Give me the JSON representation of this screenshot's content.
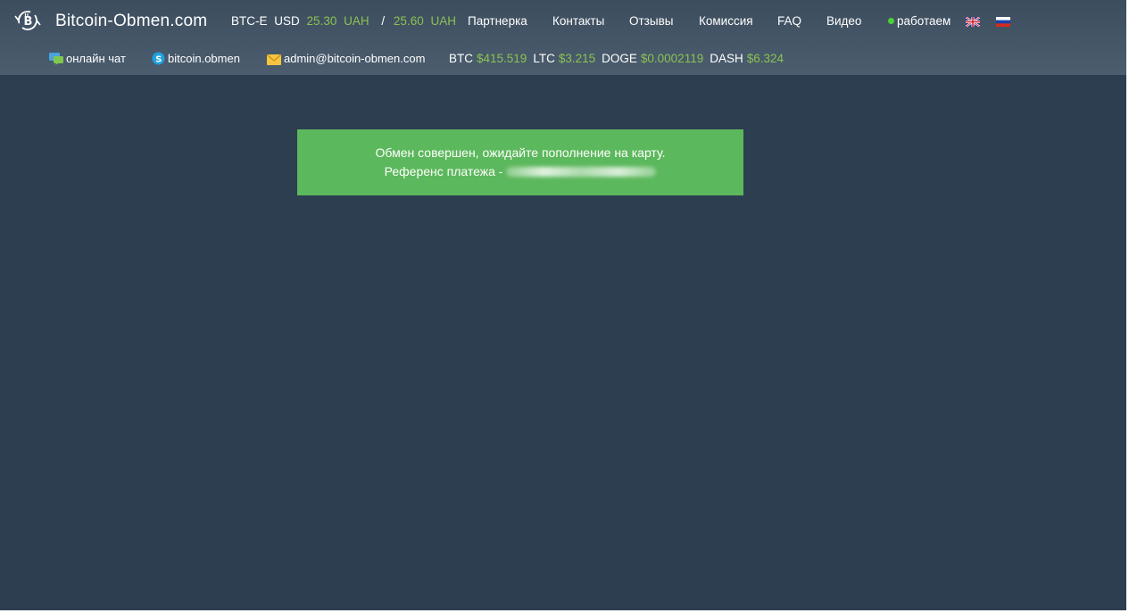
{
  "header": {
    "site_name": "Bitcoin-Obmen.com",
    "rates": {
      "exchange": "BTC-E",
      "currency": "USD",
      "buy_value": "25.30",
      "buy_unit": "UAH",
      "separator": "/",
      "sell_value": "25.60",
      "sell_unit": "UAH"
    },
    "nav": [
      {
        "label": "Партнерка"
      },
      {
        "label": "Контакты"
      },
      {
        "label": "Отзывы"
      },
      {
        "label": "Комиссия"
      },
      {
        "label": "FAQ"
      },
      {
        "label": "Видео"
      }
    ],
    "status_label": "работаем",
    "languages": [
      "en-flag-icon",
      "ru-flag-icon"
    ]
  },
  "subheader": {
    "chat_label": "онлайн чат",
    "skype_label": "bitcoin.obmen",
    "email_label": "admin@bitcoin-obmen.com",
    "crypto": [
      {
        "symbol": "BTC",
        "price": "$415.519"
      },
      {
        "symbol": "LTC",
        "price": "$3.215"
      },
      {
        "symbol": "DOGE",
        "price": "$0.0002119"
      },
      {
        "symbol": "DASH",
        "price": "$6.324"
      }
    ]
  },
  "alert": {
    "line1": "Обмен совершен, ожидайте пополнение на карту.",
    "line2_prefix": "Референс платежа -"
  },
  "colors": {
    "background": "#2c3e50",
    "header": "#46586a",
    "accent_green": "#8cc152",
    "success": "#5cb85c",
    "status_dot": "#4cd137"
  }
}
